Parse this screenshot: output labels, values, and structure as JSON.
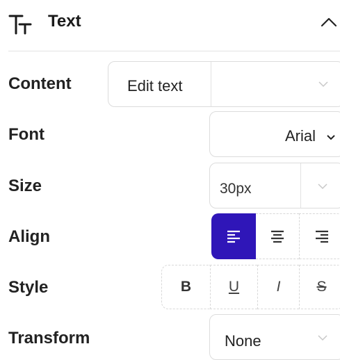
{
  "header": {
    "title": "Text",
    "icon": "text-icon",
    "collapse_icon": "chevron-up-icon"
  },
  "rows": {
    "content": {
      "label": "Content",
      "value": "Edit text"
    },
    "font": {
      "label": "Font",
      "value": "Arial"
    },
    "size": {
      "label": "Size",
      "value": "30px"
    },
    "align": {
      "label": "Align",
      "options": [
        "align-left",
        "align-center",
        "align-right"
      ],
      "selected": "align-left"
    },
    "style": {
      "label": "Style",
      "options": [
        "B",
        "U",
        "I",
        "S"
      ]
    },
    "transform": {
      "label": "Transform",
      "value": "None"
    }
  },
  "colors": {
    "accent": "#2f16b8",
    "border": "#dcdcdc",
    "text": "#1e1e1e"
  }
}
